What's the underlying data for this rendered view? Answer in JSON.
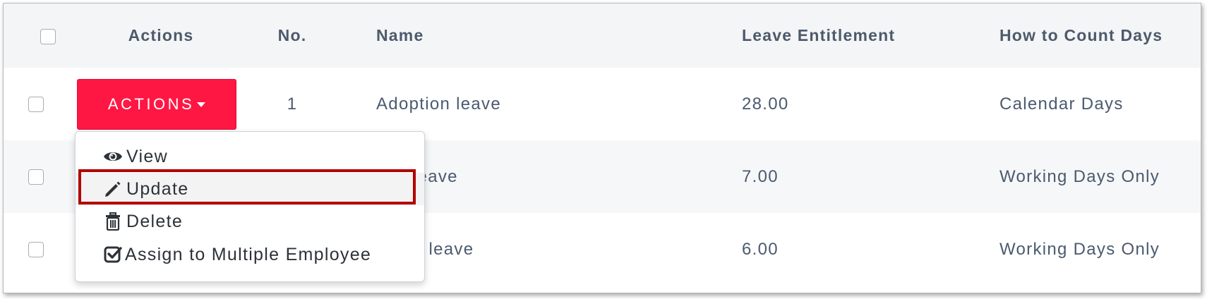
{
  "table": {
    "headers": {
      "actions": "Actions",
      "no": "No.",
      "name": "Name",
      "entitlement": "Leave Entitlement",
      "count_days": "How to Count Days"
    },
    "rows": [
      {
        "no": "1",
        "name": "Adoption leave",
        "entitlement": "28.00",
        "count_days": "Calendar Days"
      },
      {
        "no": "",
        "name": "ual Leave",
        "entitlement": "7.00",
        "count_days": "Working Days Only"
      },
      {
        "no": "",
        "name": "dcare leave",
        "entitlement": "6.00",
        "count_days": "Working Days Only"
      }
    ],
    "actions_button_label": "ACTIONS"
  },
  "dropdown": {
    "items": [
      {
        "label": "View",
        "icon": "eye-icon"
      },
      {
        "label": "Update",
        "icon": "pencil-icon"
      },
      {
        "label": "Delete",
        "icon": "trash-icon"
      },
      {
        "label": "Assign to Multiple Employee",
        "icon": "check-square-icon"
      }
    ],
    "highlighted_item": "Update"
  },
  "colors": {
    "accent": "#ff1744",
    "highlight_border": "#b30000",
    "header_bg": "#f4f5f6",
    "text": "#4b5a6f"
  }
}
